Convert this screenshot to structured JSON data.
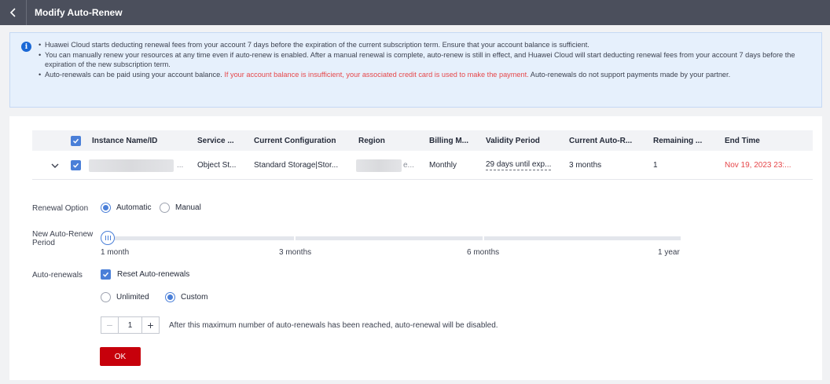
{
  "header": {
    "title": "Modify Auto-Renew"
  },
  "notice": {
    "items": [
      {
        "text": "Huawei Cloud starts deducting renewal fees from your account 7 days before the expiration of the current subscription term. Ensure that your account balance is sufficient."
      },
      {
        "text": "You can manually renew your resources at any time even if auto-renew is enabled. After a manual renewal is complete, auto-renew is still in effect, and Huawei Cloud will start deducting renewal fees from your account 7 days before the expiration of the new subscription term."
      },
      {
        "text_before": "Auto-renewals can be paid using your account balance. ",
        "text_red": "If your account balance is insufficient, your associated credit card is used to make the payment.",
        "text_after": " Auto-renewals do not support payments made by your partner."
      }
    ]
  },
  "table": {
    "headers": [
      "Instance Name/ID",
      "Service ...",
      "Current Configuration",
      "Region",
      "Billing M...",
      "Validity Period",
      "Current Auto-R...",
      "Remaining ...",
      "End Time"
    ],
    "row": {
      "name_suffix": "...",
      "service": "Object St...",
      "configuration": "Standard Storage|Stor...",
      "region_suffix": "e...",
      "billing": "Monthly",
      "validity": "29 days until exp...",
      "auto_renew": "3 months",
      "remaining": "1",
      "end_time": "Nov 19, 2023 23:..."
    }
  },
  "form": {
    "renewal_option_label": "Renewal Option",
    "automatic": "Automatic",
    "manual": "Manual",
    "period_label": "New Auto-Renew Period",
    "period_ticks": [
      "1 month",
      "3 months",
      "6 months",
      "1 year"
    ],
    "period_selected": "1 month",
    "auto_renewals_label": "Auto-renewals",
    "reset_label": "Reset Auto-renewals",
    "unlimited": "Unlimited",
    "custom": "Custom",
    "count_value": "1",
    "count_hint": "After this maximum number of auto-renewals has been reached, auto-renewal will be disabled.",
    "ok_label": "OK"
  },
  "colors": {
    "accent": "#4a7fd8",
    "primary_button": "#c7000b",
    "warning_text": "#e6474a",
    "topbar": "#4b4f5c"
  }
}
